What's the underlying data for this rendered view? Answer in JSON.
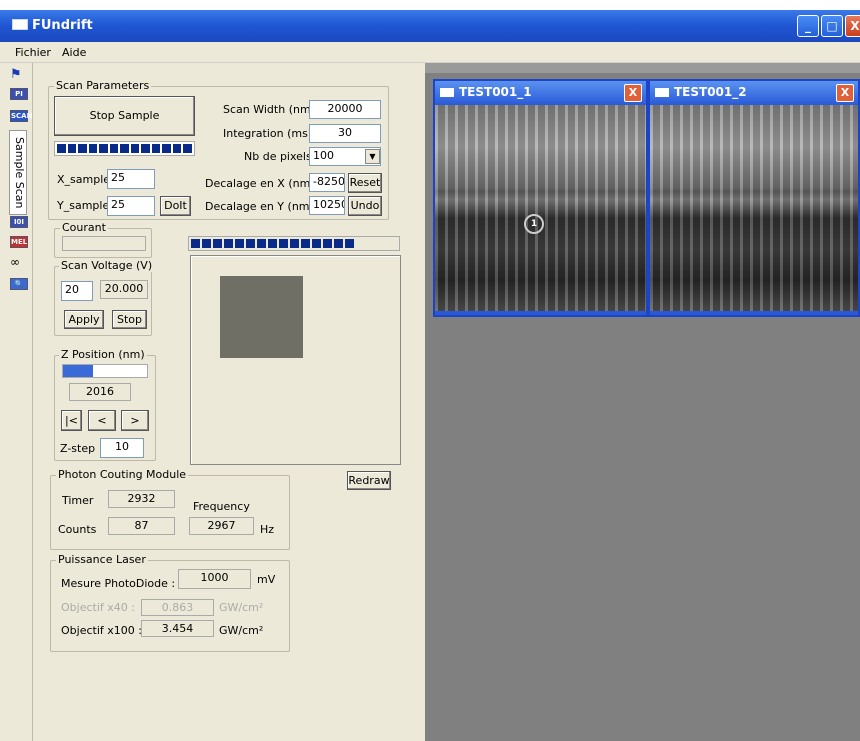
{
  "window": {
    "title": "FUndrift",
    "controls": [
      "_",
      "□",
      "X"
    ]
  },
  "menu": [
    "Fichier",
    "Aide"
  ],
  "sidebar": {
    "icons": [
      "PI",
      "SCAN",
      "I0I",
      "MEL"
    ],
    "vertical_tab": "Sample Scan"
  },
  "scan": {
    "legend": "Scan Parameters",
    "stop_sample": "Stop Sample",
    "x_label": "X_sample",
    "x_val": "25",
    "y_label": "Y_sample",
    "y_val": "25",
    "doit": "DoIt",
    "width_label": "Scan Width (nm)",
    "width_val": "20000",
    "integ_label": "Integration (ms)",
    "integ_val": "30",
    "pix_label": "Nb de pixels",
    "pix_val": "100",
    "decx_label": "Decalage en X (nm)",
    "decx_val": "-8250",
    "reset": "Reset",
    "decy_label": "Decalage en Y (nm)",
    "decy_val": "10250",
    "undo": "Undo"
  },
  "courant": {
    "legend": "Courant"
  },
  "voltage": {
    "legend": "Scan Voltage (V)",
    "input": "20",
    "display": "20.000",
    "apply": "Apply",
    "stop": "Stop"
  },
  "zpos": {
    "legend": "Z Position (nm)",
    "value": "2016",
    "first": "|<",
    "prev": "<",
    "next": ">",
    "step_label": "Z-step",
    "step_val": "10"
  },
  "redraw": "Redraw",
  "photon": {
    "legend": "Photon Couting Module",
    "timer_label": "Timer",
    "timer": "2932",
    "counts_label": "Counts",
    "counts": "87",
    "freq_label": "Frequency",
    "freq": "2967",
    "hz": "Hz"
  },
  "laser": {
    "legend": "Puissance Laser",
    "mesure_label": "Mesure PhotoDiode :",
    "mesure": "1000",
    "mv": "mV",
    "x40_label": "Objectif x40 :",
    "x40": "0.863",
    "x40_unit": "GW/cm²",
    "x100_label": "Objectif x100 :",
    "x100": "3.454",
    "x100_unit": "GW/cm²"
  },
  "children": [
    {
      "title": "TEST001_1",
      "close": "X"
    },
    {
      "title": "TEST001_2",
      "close": "X"
    }
  ],
  "marker": "1"
}
